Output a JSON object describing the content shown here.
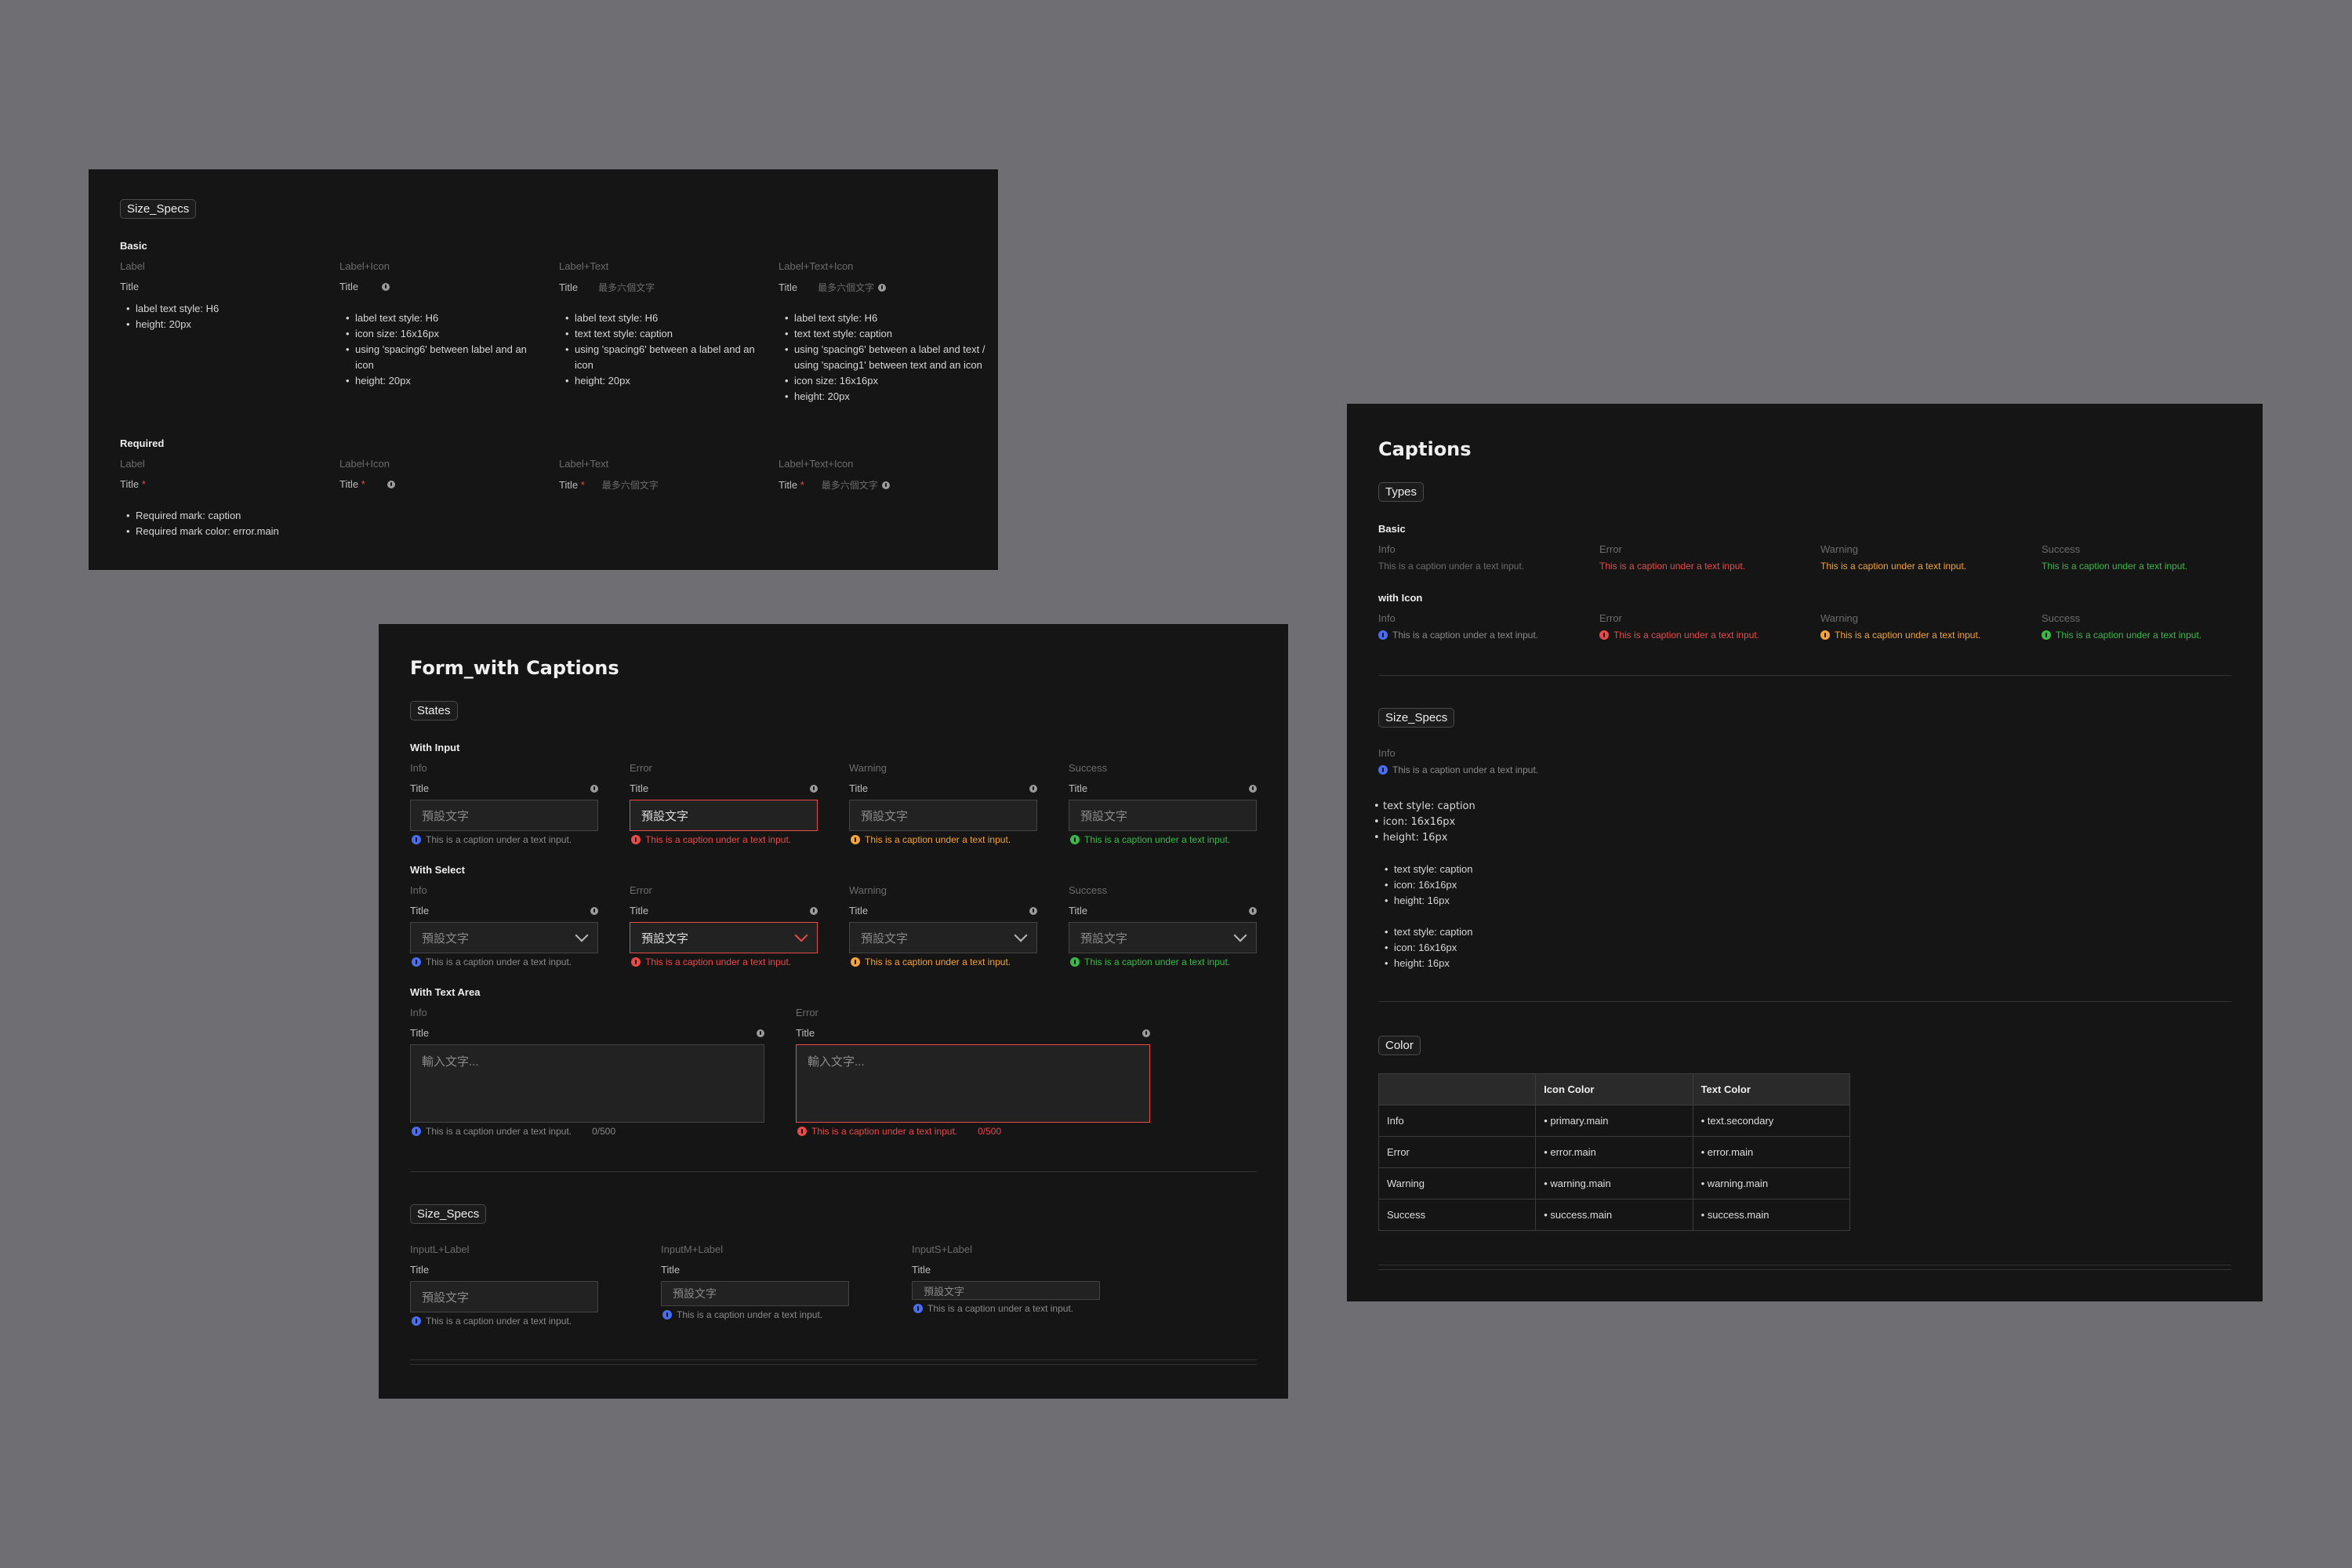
{
  "colors": {
    "info": "#4a6cf0",
    "error": "#e84a4a",
    "warning": "#f2a33a",
    "success": "#3cb84a",
    "bg": "#151515",
    "canvas": "#6f6e73"
  },
  "label_card": {
    "tag": "Size_Specs",
    "basic": "Basic",
    "required": "Required",
    "cols": [
      "Label",
      "Label+Icon",
      "Label+Text",
      "Label+Text+Icon"
    ],
    "title": "Title",
    "hint": "最多六個文字",
    "star": "*",
    "specs": [
      [
        "label text style: H6",
        "height: 20px"
      ],
      [
        "label text style: H6",
        "icon size: 16x16px",
        "using 'spacing6' between label and an icon",
        "height: 20px"
      ],
      [
        "label text style: H6",
        "text text style: caption",
        "using 'spacing6' between a label and an icon",
        "height: 20px"
      ],
      [
        "label text style: H6",
        "text text style: caption",
        "using 'spacing6' between a label and text / using 'spacing1' between text and an icon",
        "icon size: 16x16px",
        "height: 20px"
      ]
    ],
    "required_specs": [
      "Required mark: caption",
      "Required mark color: error.main"
    ]
  },
  "form_card": {
    "title": "Form_with Captions",
    "tag_states": "States",
    "with_input": "With Input",
    "with_select": "With Select",
    "with_textarea": "With Text Area",
    "states": [
      "Info",
      "Error",
      "Warning",
      "Success"
    ],
    "field_title": "Title",
    "placeholder": "預設文字",
    "ta_placeholder": "輸入文字...",
    "caption": "This is a caption under a text input.",
    "counter": "0/500",
    "tag_size": "Size_Specs",
    "sizes": [
      "InputL+Label",
      "InputM+Label",
      "InputS+Label"
    ]
  },
  "captions_card": {
    "title": "Captions",
    "tag_types": "Types",
    "basic": "Basic",
    "with_icon": "with Icon",
    "states": [
      "Info",
      "Error",
      "Warning",
      "Success"
    ],
    "caption": "This is a caption under a text input.",
    "tag_size": "Size_Specs",
    "size_info": "Info",
    "spec_groups": [
      [
        "text style: caption",
        "icon: 16x16px",
        "height: 16px"
      ],
      [
        "text style: caption",
        "icon: 16x16px",
        "height: 16px"
      ],
      [
        "text style: caption",
        "icon: 16x16px",
        "height: 16px"
      ]
    ],
    "tag_color": "Color",
    "table": {
      "headers": [
        "",
        "Icon Color",
        "Text Color"
      ],
      "rows": [
        [
          "Info",
          "primary.main",
          "text.secondary"
        ],
        [
          "Error",
          "error.main",
          "error.main"
        ],
        [
          "Warning",
          "warning.main",
          "warning.main"
        ],
        [
          "Success",
          "success.main",
          "success.main"
        ]
      ]
    }
  }
}
